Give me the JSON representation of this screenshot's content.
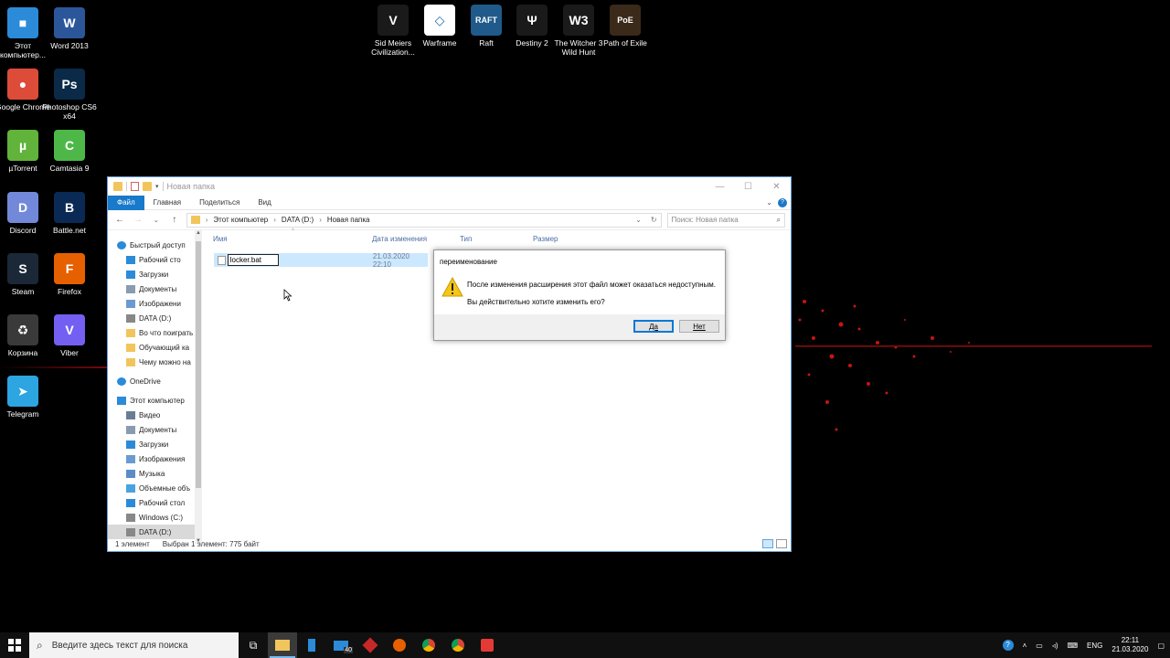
{
  "desktop": {
    "icons": [
      {
        "label": "Этот компьютер...",
        "color": "#2b8bd8",
        "glyph": "■"
      },
      {
        "label": "Word 2013",
        "color": "#2b579a",
        "glyph": "W"
      },
      {
        "label": "Google Chrome",
        "color": "#dd4b39",
        "glyph": "●"
      },
      {
        "label": "Photoshop CS6 x64",
        "color": "#0a2a48",
        "glyph": "Ps"
      },
      {
        "label": "µTorrent",
        "color": "#61b33b",
        "glyph": "µ"
      },
      {
        "label": "Camtasia 9",
        "color": "#4db848",
        "glyph": "C"
      },
      {
        "label": "Discord",
        "color": "#7289da",
        "glyph": "D"
      },
      {
        "label": "Battle.net",
        "color": "#0a2a55",
        "glyph": "B"
      },
      {
        "label": "Steam",
        "color": "#1b2838",
        "glyph": "S"
      },
      {
        "label": "Firefox",
        "color": "#e66000",
        "glyph": "F"
      },
      {
        "label": "Корзина",
        "color": "#3a3a3a",
        "glyph": "♻"
      },
      {
        "label": "Viber",
        "color": "#7360f2",
        "glyph": "V"
      },
      {
        "label": "Telegram",
        "color": "#2ca5e0",
        "glyph": "➤"
      },
      {
        "label": "Sid Meiers Civilization...",
        "color": "#1a1a1a",
        "glyph": "V"
      },
      {
        "label": "Warframe",
        "color": "#ffffff",
        "glyph": "◇"
      },
      {
        "label": "Raft",
        "color": "#1f5a8a",
        "glyph": "RAFT"
      },
      {
        "label": "Destiny 2",
        "color": "#1a1a1a",
        "glyph": "Ψ"
      },
      {
        "label": "The Witcher 3 Wild Hunt",
        "color": "#1a1a1a",
        "glyph": "W3"
      },
      {
        "label": "Path of Exile",
        "color": "#3b2a1a",
        "glyph": "PoE"
      }
    ]
  },
  "explorer": {
    "title": "Новая папка",
    "ribbon_tabs": [
      "Файл",
      "Главная",
      "Поделиться",
      "Вид"
    ],
    "address": {
      "parts": [
        "Этот компьютер",
        "DATA (D:)",
        "Новая папка"
      ]
    },
    "search_placeholder": "Поиск: Новая папка",
    "columns": {
      "name": "Имя",
      "date": "Дата изменения",
      "type": "Тип",
      "size": "Размер"
    },
    "nav": [
      {
        "label": "Быстрый доступ",
        "type": "star",
        "pinned": false
      },
      {
        "label": "Рабочий сто",
        "type": "folder-blue",
        "pinned": true
      },
      {
        "label": "Загрузки",
        "type": "download",
        "pinned": true
      },
      {
        "label": "Документы",
        "type": "doc",
        "pinned": true
      },
      {
        "label": "Изображени",
        "type": "image",
        "pinned": true
      },
      {
        "label": "DATA (D:)",
        "type": "drive",
        "pinned": false
      },
      {
        "label": "Во что поиграть",
        "type": "folder",
        "pinned": false
      },
      {
        "label": "Обучающий ка",
        "type": "folder",
        "pinned": false
      },
      {
        "label": "Чему можно на",
        "type": "folder",
        "pinned": false
      },
      {
        "label": "OneDrive",
        "type": "cloud",
        "pinned": false
      },
      {
        "label": "Этот компьютер",
        "type": "pc",
        "pinned": false
      },
      {
        "label": "Видео",
        "type": "video",
        "pinned": false
      },
      {
        "label": "Документы",
        "type": "doc",
        "pinned": false
      },
      {
        "label": "Загрузки",
        "type": "download",
        "pinned": false
      },
      {
        "label": "Изображения",
        "type": "image",
        "pinned": false
      },
      {
        "label": "Музыка",
        "type": "music",
        "pinned": false
      },
      {
        "label": "Объемные объ",
        "type": "3d",
        "pinned": false
      },
      {
        "label": "Рабочий стол",
        "type": "folder-blue",
        "pinned": false
      },
      {
        "label": "Windows (C:)",
        "type": "drive",
        "pinned": false
      },
      {
        "label": "DATA (D:)",
        "type": "drive",
        "pinned": false
      }
    ],
    "file": {
      "name": "locker.bat",
      "date": "21.03.2020 22:10"
    },
    "status": {
      "count": "1 элемент",
      "selected": "Выбран 1 элемент: 775 байт"
    }
  },
  "dialog": {
    "title": "переименование",
    "message": "После изменения расширения этот файл может оказаться недоступным.",
    "question": "Вы действительно хотите изменить его?",
    "yes": "Да",
    "no": "Нет"
  },
  "taskbar": {
    "search_placeholder": "Введите здесь текст для поиска",
    "lang": "ENG",
    "time": "22:11",
    "date": "21.03.2020",
    "mail_badge": "40"
  }
}
